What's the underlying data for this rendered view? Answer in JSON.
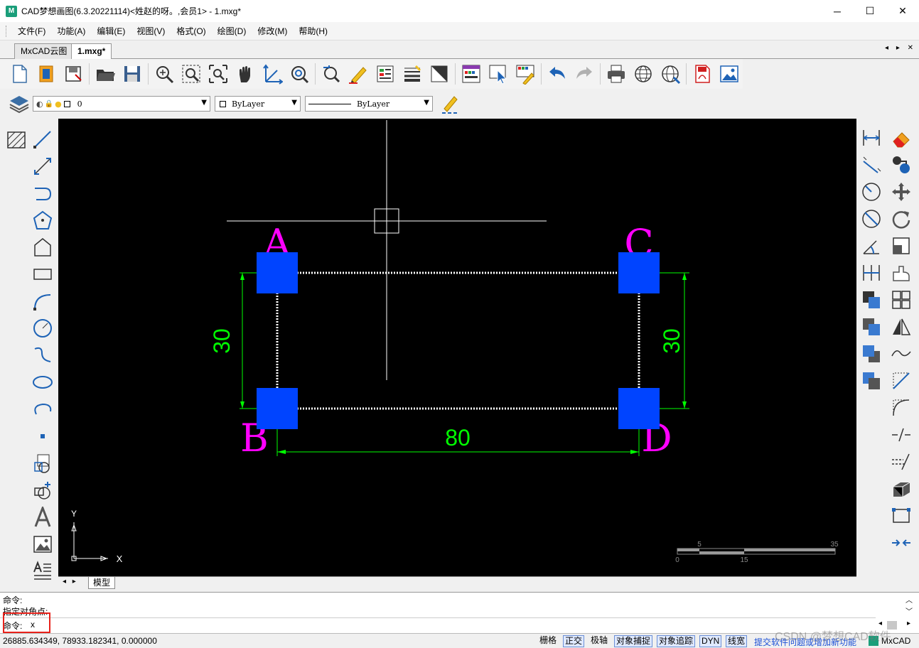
{
  "window": {
    "title": "CAD梦想画图(6.3.20221114)<姓赵的呀。,会员1> - 1.mxg*",
    "icon_text": "M",
    "minimize": "─",
    "maximize": "☐",
    "close": "✕"
  },
  "menu": [
    "文件(F)",
    "功能(A)",
    "编辑(E)",
    "视图(V)",
    "格式(O)",
    "绘图(D)",
    "修改(M)",
    "帮助(H)"
  ],
  "tabs": [
    {
      "label": "MxCAD云图"
    },
    {
      "label": "1.mxg*"
    }
  ],
  "tab_nav": "◂ ▸ ✕",
  "property_bar": {
    "layer": "0",
    "color": "ByLayer",
    "linetype": "ByLayer"
  },
  "drawing": {
    "labels": [
      "A",
      "B",
      "C",
      "D"
    ],
    "dim_width": "80",
    "dim_left": "30",
    "dim_right": "30",
    "axis_x": "X",
    "axis_y": "Y",
    "scale_ticks_top": [
      "5",
      "35"
    ],
    "scale_ticks_bottom": [
      "0",
      "15"
    ],
    "colors": {
      "label": "#ff00ff",
      "dimension": "#00ff00",
      "block": "#0044ff",
      "line": "#ffffff"
    }
  },
  "layout_tabs": {
    "nav": "◂ ▸",
    "model": "模型"
  },
  "command": {
    "line1": "命令:",
    "line2": "  指定对角点:",
    "prompt": "命令:",
    "input": "x"
  },
  "status": {
    "coords": "26885.634349,  78933.182341,  0.000000",
    "buttons": [
      {
        "label": "栅格",
        "on": false
      },
      {
        "label": "正交",
        "on": true
      },
      {
        "label": "极轴",
        "on": false
      },
      {
        "label": "对象捕捉",
        "on": true
      },
      {
        "label": "对象追踪",
        "on": true
      },
      {
        "label": "DYN",
        "on": true
      },
      {
        "label": "线宽",
        "on": true
      }
    ],
    "feedback_link": "提交软件问题或增加新功能",
    "brand": "MxCAD",
    "watermark": "CSDN @梦想CAD软件"
  }
}
